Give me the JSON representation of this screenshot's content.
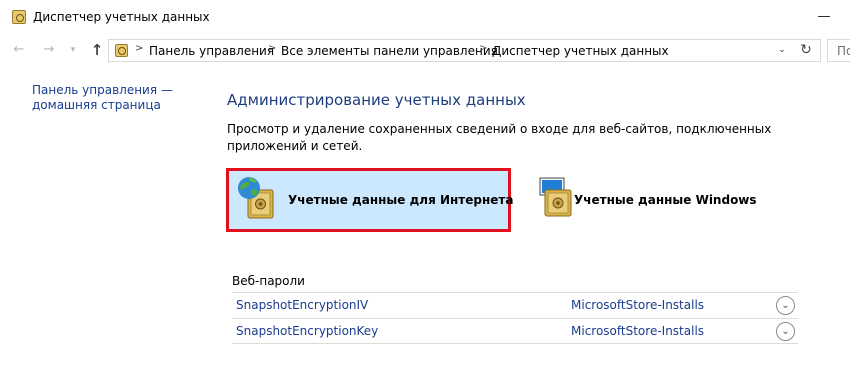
{
  "window": {
    "title": "Диспетчер учетных данных",
    "minimize_icon": "minimize-icon"
  },
  "nav": {
    "back_icon": "arrow-left-icon",
    "forward_icon": "arrow-right-icon",
    "up_icon": "arrow-up-icon",
    "breadcrumbs": [
      "Панель управления",
      "Все элементы панели управления",
      "Диспетчер учетных данных"
    ],
    "search_placeholder": "По"
  },
  "sidebar": {
    "home_link": "Панель управления — домашняя страница"
  },
  "main": {
    "heading": "Администрирование учетных данных",
    "description": "Просмотр и удаление сохраненных сведений о входе для веб-сайтов, подключенных приложений и сетей.",
    "tiles": [
      {
        "label": "Учетные данные для Интернета",
        "selected": true,
        "icon": "web-credentials-icon"
      },
      {
        "label": "Учетные данные Windows",
        "selected": false,
        "icon": "windows-credentials-icon"
      }
    ],
    "section_title": "Веб-пароли",
    "entries": [
      {
        "name": "SnapshotEncryptionIV",
        "source": "MicrosoftStore-Installs"
      },
      {
        "name": "SnapshotEncryptionKey",
        "source": "MicrosoftStore-Installs"
      }
    ]
  },
  "colors": {
    "link": "#1a3c8f",
    "heading": "#1e3d7b",
    "selected_tile_bg": "#cce8ff",
    "selected_tile_border": "#e0101d"
  }
}
